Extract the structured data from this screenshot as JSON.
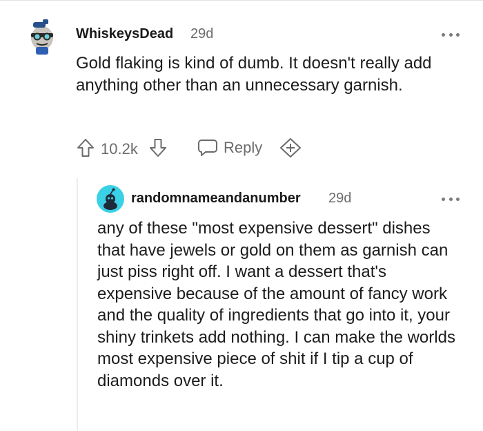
{
  "comment": {
    "username": "WhiskeysDead",
    "age": "29d",
    "body": "Gold flaking is kind of dumb. It doesn't really add anything other than an unnecessary garnish.",
    "votes": "10.2k",
    "reply_label": "Reply",
    "icons": [
      "avatar-icon",
      "more-options-icon",
      "upvote-icon",
      "downvote-icon",
      "reply-icon",
      "award-icon"
    ]
  },
  "reply": {
    "username": "randomnameandanumber",
    "age": "29d",
    "body": "any of these \"most expensive dessert\" dishes that have jewels or gold on them as garnish can just piss right off. I want a dessert that's expensive because of the amount of fancy work and the quality of ingredients that go into it, your shiny trinkets add nothing. I can make the worlds most expensive piece of shit if I tip a cup of diamonds over it.",
    "icons": [
      "avatar-icon",
      "more-options-icon"
    ]
  },
  "colors": {
    "text": "#1c1c1c",
    "meta": "#6b6b6b",
    "reply_avatar_bg": "#3ad0e5",
    "divider": "#e4e4e4"
  }
}
